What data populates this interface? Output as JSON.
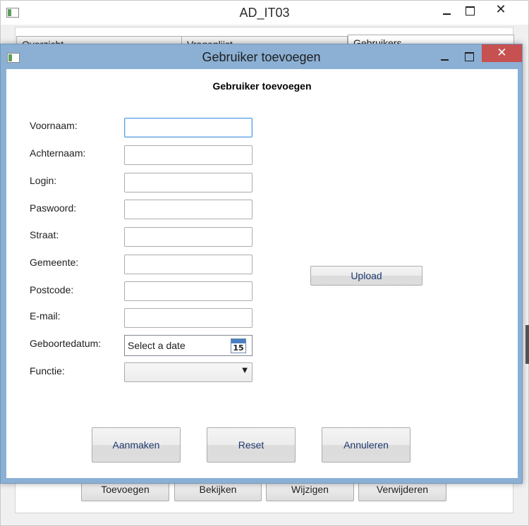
{
  "parent_window": {
    "title": "AD_IT03",
    "close_glyph": "✕",
    "tabs": [
      {
        "label": "Overzicht"
      },
      {
        "label": "Vragenlijst"
      },
      {
        "label": "Gebruikers"
      }
    ],
    "buttons": [
      {
        "label": "Toevoegen"
      },
      {
        "label": "Bekijken"
      },
      {
        "label": "Wijzigen"
      },
      {
        "label": "Verwijderen"
      }
    ]
  },
  "dialog": {
    "title": "Gebruiker toevoegen",
    "close_glyph": "✕",
    "heading": "Gebruiker toevoegen",
    "fields": [
      {
        "label": "Voornaam:",
        "value": "",
        "focused": true
      },
      {
        "label": "Achternaam:",
        "value": ""
      },
      {
        "label": "Login:",
        "value": ""
      },
      {
        "label": "Paswoord:",
        "value": ""
      },
      {
        "label": "Straat:",
        "value": ""
      },
      {
        "label": "Gemeente:",
        "value": ""
      },
      {
        "label": "Postcode:",
        "value": ""
      },
      {
        "label": "E-mail:",
        "value": ""
      }
    ],
    "birthdate": {
      "label": "Geboortedatum:",
      "placeholder": "Select a date",
      "calendar_day": "15"
    },
    "function": {
      "label": "Functie:",
      "selected": "",
      "arrow": "▼"
    },
    "upload_label": "Upload",
    "actions": {
      "create": "Aanmaken",
      "reset": "Reset",
      "cancel": "Annuleren"
    }
  },
  "icons": {
    "app": "app-window-icon",
    "calendar": "calendar-icon",
    "dropdown": "chevron-down-icon"
  },
  "colors": {
    "dialog_frame": "#8bb0d4",
    "close_button": "#c75050",
    "focus_border": "#569de5",
    "button_text": "#1e3a6e"
  }
}
